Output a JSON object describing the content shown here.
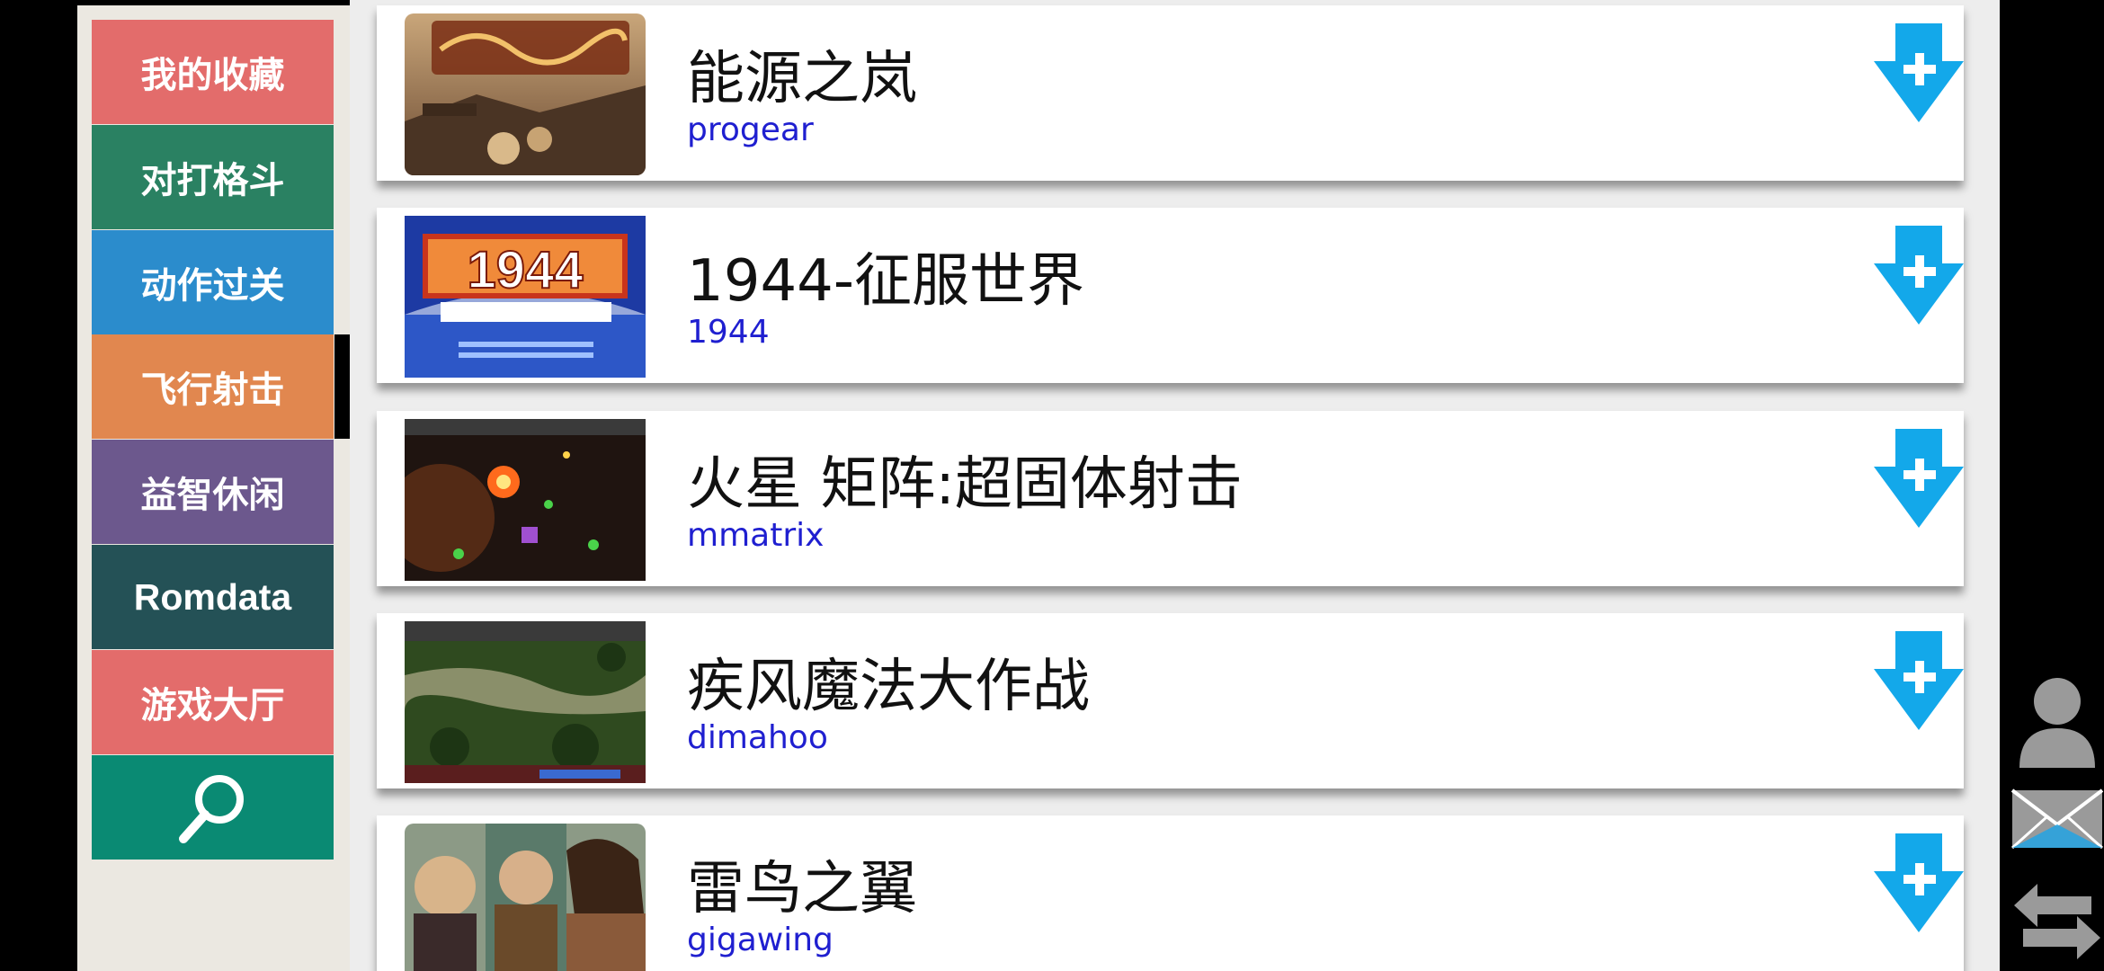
{
  "sidebar": {
    "categories": [
      {
        "label": "我的收藏",
        "color": "#e36c6b"
      },
      {
        "label": "对打格斗",
        "color": "#2a8162"
      },
      {
        "label": "动作过关",
        "color": "#2b8ccc"
      },
      {
        "label": "飞行射击",
        "color": "#e1874f"
      },
      {
        "label": "益智休闲",
        "color": "#6c588d"
      },
      {
        "label": "Romdata",
        "color": "#245156"
      },
      {
        "label": "游戏大厅",
        "color": "#e36c6b"
      }
    ],
    "search": {
      "icon": "search-icon",
      "color": "#0a8a73"
    },
    "active_index": 3
  },
  "games": [
    {
      "title": "能源之岚",
      "rom": "progear",
      "thumb": "progear"
    },
    {
      "title": "1944-征服世界",
      "rom": "1944",
      "thumb": "1944"
    },
    {
      "title": "火星 矩阵:超固体射击",
      "rom": "mmatrix",
      "thumb": "mmatrix"
    },
    {
      "title": "疾风魔法大作战",
      "rom": "dimahoo",
      "thumb": "dimahoo"
    },
    {
      "title": "雷鸟之翼",
      "rom": "gigawing",
      "thumb": "gigawing"
    }
  ],
  "colors": {
    "download": "#13a8ea",
    "rom_text": "#1f1fd0",
    "rail_icon": "#9a9a9a",
    "mail_accent": "#2aa3df"
  },
  "rail": [
    "user-icon",
    "mail-icon",
    "swap-icon"
  ]
}
